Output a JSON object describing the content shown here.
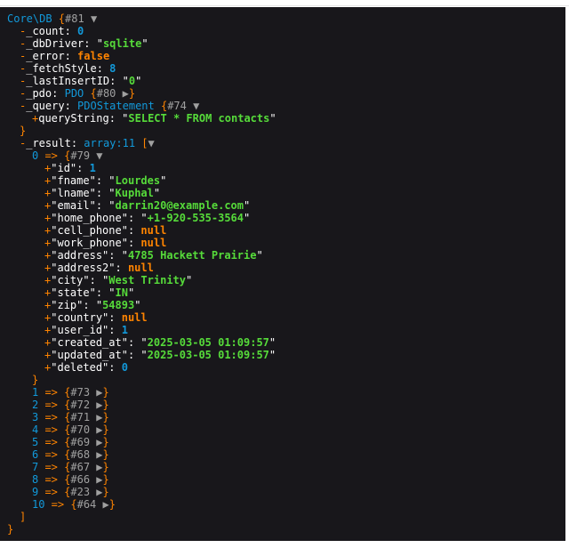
{
  "root": {
    "class": "Core\\DB",
    "id": "#81"
  },
  "props": [
    {
      "key": "_count",
      "type": "num",
      "value": "0"
    },
    {
      "key": "_dbDriver",
      "type": "str",
      "value": "sqlite"
    },
    {
      "key": "_error",
      "type": "bool",
      "value": "false"
    },
    {
      "key": "_fetchStyle",
      "type": "num",
      "value": "8"
    },
    {
      "key": "_lastInsertID",
      "type": "str",
      "value": "0"
    },
    {
      "key": "_pdo",
      "type": "obj",
      "class": "PDO",
      "id": "#80"
    }
  ],
  "query": {
    "key": "_query",
    "class": "PDOStatement",
    "id": "#74",
    "child_key": "queryString",
    "child_value": "SELECT * FROM contacts"
  },
  "result": {
    "key": "_result",
    "type": "array:11",
    "first": {
      "index": "0",
      "id": "#79",
      "fields": [
        {
          "key": "id",
          "type": "num",
          "value": "1"
        },
        {
          "key": "fname",
          "type": "str",
          "value": "Lourdes"
        },
        {
          "key": "lname",
          "type": "str",
          "value": "Kuphal"
        },
        {
          "key": "email",
          "type": "str",
          "value": "darrin20@example.com"
        },
        {
          "key": "home_phone",
          "type": "str",
          "value": "+1-920-535-3564"
        },
        {
          "key": "cell_phone",
          "type": "null",
          "value": "null"
        },
        {
          "key": "work_phone",
          "type": "null",
          "value": "null"
        },
        {
          "key": "address",
          "type": "str",
          "value": "4785 Hackett Prairie"
        },
        {
          "key": "address2",
          "type": "null",
          "value": "null"
        },
        {
          "key": "city",
          "type": "str",
          "value": "West Trinity"
        },
        {
          "key": "state",
          "type": "str",
          "value": "IN"
        },
        {
          "key": "zip",
          "type": "str",
          "value": "54893"
        },
        {
          "key": "country",
          "type": "null",
          "value": "null"
        },
        {
          "key": "user_id",
          "type": "num",
          "value": "1"
        },
        {
          "key": "created_at",
          "type": "str",
          "value": "2025-03-05 01:09:57"
        },
        {
          "key": "updated_at",
          "type": "str",
          "value": "2025-03-05 01:09:57"
        },
        {
          "key": "deleted",
          "type": "num",
          "value": "0"
        }
      ]
    },
    "collapsed": [
      {
        "index": "1",
        "id": "#73"
      },
      {
        "index": "2",
        "id": "#72"
      },
      {
        "index": "3",
        "id": "#71"
      },
      {
        "index": "4",
        "id": "#70"
      },
      {
        "index": "5",
        "id": "#69"
      },
      {
        "index": "6",
        "id": "#68"
      },
      {
        "index": "7",
        "id": "#67"
      },
      {
        "index": "8",
        "id": "#66"
      },
      {
        "index": "9",
        "id": "#23"
      },
      {
        "index": "10",
        "id": "#64"
      }
    ]
  },
  "symbols": {
    "protected": "-",
    "public": "+",
    "arrow": "=>",
    "expanded": "▼",
    "collapsed": "▶"
  }
}
